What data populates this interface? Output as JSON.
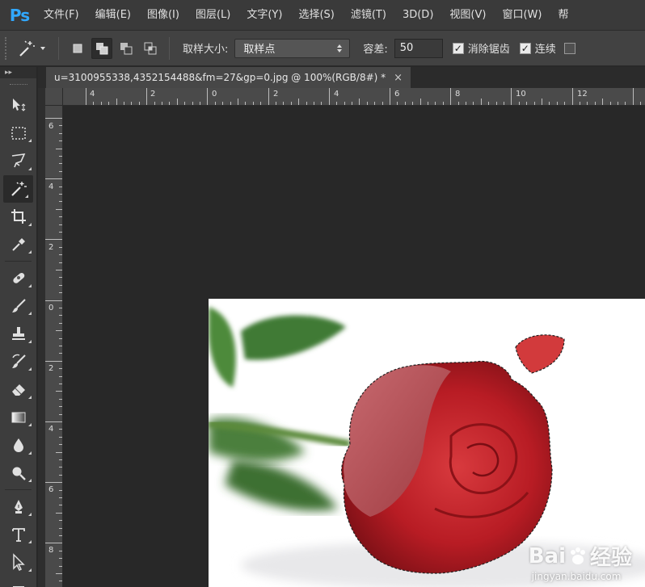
{
  "app": {
    "logo": "Ps",
    "menu": [
      "文件(F)",
      "编辑(E)",
      "图像(I)",
      "图层(L)",
      "文字(Y)",
      "选择(S)",
      "滤镜(T)",
      "3D(D)",
      "视图(V)",
      "窗口(W)",
      "帮"
    ]
  },
  "options": {
    "sample_size_label": "取样大小:",
    "sample_size_value": "取样点",
    "tolerance_label": "容差:",
    "tolerance_value": "50",
    "anti_alias_label": "消除锯齿",
    "contiguous_label": "连续"
  },
  "document": {
    "tab_title": "u=3100955338,4352154488&fm=27&gp=0.jpg @ 100%(RGB/8#) *",
    "close": "×"
  },
  "rulers": {
    "top": [
      "4",
      "2",
      "0",
      "2",
      "4",
      "6",
      "8",
      "10",
      "12"
    ],
    "left": [
      "6",
      "4",
      "2",
      "0",
      "2",
      "4",
      "6",
      "8"
    ]
  },
  "watermark": {
    "brand": "Bai",
    "brand_cn": "经验",
    "url": "jingyan.baidu.com"
  },
  "colors": {
    "accent": "#31a8ff",
    "canvas": "#282828",
    "rose": "#c0202a"
  }
}
